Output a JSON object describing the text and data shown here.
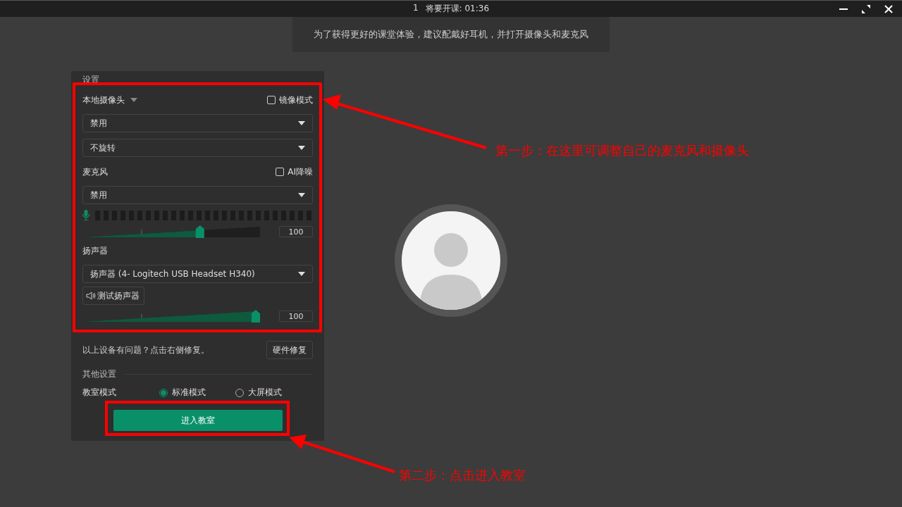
{
  "title_bar": {
    "number": "1",
    "countdown": "将要开课: 01:36"
  },
  "notice": "为了获得更好的课堂体验，建议配戴好耳机，并打开摄像头和麦克风",
  "settings": {
    "title": "设置",
    "camera": {
      "label": "本地摄像头",
      "mirror": {
        "label": "镜像模式",
        "checked": false
      },
      "device": "禁用",
      "rotation": "不旋转"
    },
    "microphone": {
      "label": "麦克风",
      "denoise": {
        "label": "AI降噪",
        "checked": false
      },
      "device": "禁用",
      "volume": {
        "level": 0.67,
        "reading": "100"
      }
    },
    "speaker": {
      "label": "扬声器",
      "device": "扬声器 (4- Logitech USB Headset H340)",
      "test_button": "测试扬声器",
      "volume": {
        "level": 1,
        "reading": "100"
      }
    },
    "repair": {
      "text": "以上设备有问题？点击右侧修复。",
      "button": "硬件修复"
    },
    "other": {
      "title": "其他设置",
      "mode_label": "教室模式",
      "modes": [
        {
          "label": "标准模式",
          "selected": true
        },
        {
          "label": "大屏模式",
          "selected": false
        }
      ]
    },
    "enter_button": "进入教室"
  },
  "annotations": [
    {
      "text": "第一步：在这里可调整自己的麦克风和摄像头"
    },
    {
      "text": "第二步：点击进入教室"
    }
  ]
}
